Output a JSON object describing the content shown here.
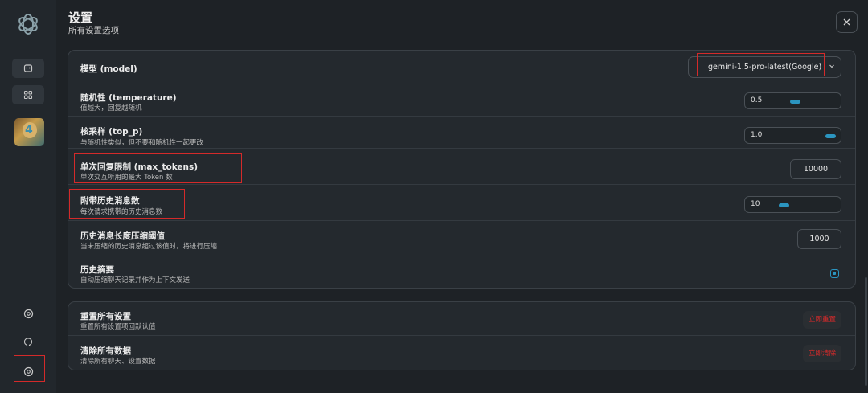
{
  "header": {
    "title": "设置",
    "subtitle": "所有设置选项"
  },
  "sidebar": {
    "top_icons": [
      "openai-logo-icon",
      "mask-icon",
      "grid-icon"
    ],
    "avatar_badge": "4",
    "bottom_icons": [
      "settings-icon",
      "github-icon",
      "settings-icon"
    ]
  },
  "settings": {
    "model": {
      "label": "模型 (model)",
      "value": "gemini-1.5-pro-latest(Google)"
    },
    "temperature": {
      "label": "随机性 (temperature)",
      "desc": "值越大，回复越随机",
      "value": "0.5",
      "fraction": 0.35
    },
    "top_p": {
      "label": "核采样 (top_p)",
      "desc": "与随机性类似，但不要和随机性一起更改",
      "value": "1.0",
      "fraction": 1.0
    },
    "max_tokens": {
      "label": "单次回复限制 (max_tokens)",
      "desc": "单次交互所用的最大 Token 数",
      "value": "10000"
    },
    "history_count": {
      "label": "附带历史消息数",
      "desc": "每次请求携带的历史消息数",
      "value": "10",
      "fraction": 0.15
    },
    "compress_threshold": {
      "label": "历史消息长度压缩阈值",
      "desc": "当未压缩的历史消息超过该值时，将进行压缩",
      "value": "1000"
    },
    "summary": {
      "label": "历史摘要",
      "desc": "自动压缩聊天记录并作为上下文发送",
      "checked": true
    }
  },
  "danger": {
    "reset": {
      "label": "重置所有设置",
      "desc": "重置所有设置项回默认值",
      "button": "立即重置"
    },
    "clear": {
      "label": "清除所有数据",
      "desc": "清除所有聊天、设置数据",
      "button": "立即清除"
    }
  },
  "colors": {
    "accent": "#2b95c0",
    "danger": "#e02a2a",
    "highlight_box": "#d42a2a"
  }
}
